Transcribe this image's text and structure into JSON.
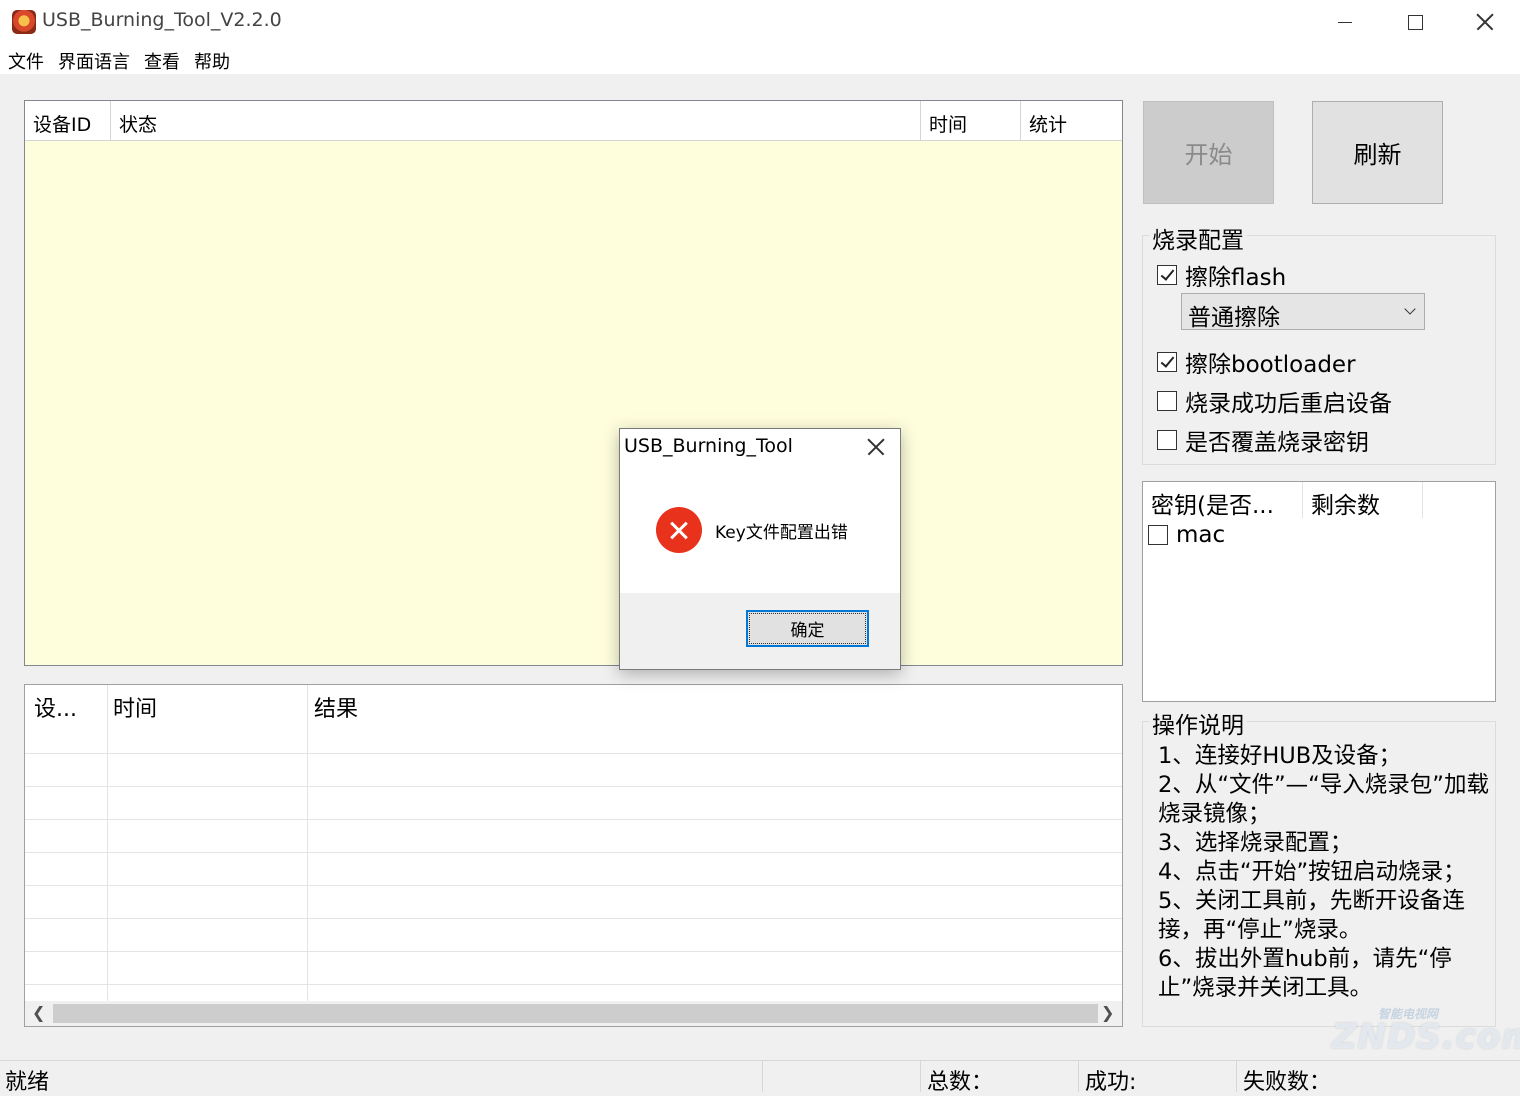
{
  "window": {
    "title": "USB_Burning_Tool_V2.2.0"
  },
  "menu": [
    "文件",
    "界面语言",
    "查看",
    "帮助"
  ],
  "device_table": {
    "columns": [
      "设备ID",
      "状态",
      "时间",
      "统计"
    ]
  },
  "log_table": {
    "columns": [
      "设...",
      "时间",
      "结果"
    ]
  },
  "buttons": {
    "start": "开始",
    "refresh": "刷新"
  },
  "burn_config": {
    "group_title": "烧录配置",
    "erase_flash": {
      "label": "擦除flash",
      "checked": true
    },
    "erase_mode": {
      "value": "普通擦除"
    },
    "erase_bootloader": {
      "label": "擦除bootloader",
      "checked": true
    },
    "reboot_after": {
      "label": "烧录成功后重启设备",
      "checked": false
    },
    "overwrite_key": {
      "label": "是否覆盖烧录密钥",
      "checked": false
    }
  },
  "key_list": {
    "columns": [
      "密钥(是否...",
      "剩余数"
    ],
    "items": [
      {
        "label": "mac",
        "checked": false
      }
    ]
  },
  "instructions": {
    "group_title": "操作说明",
    "lines": [
      "1、连接好HUB及设备；",
      "2、从“文件”—“导入烧录包”加载烧录镜像；",
      "3、选择烧录配置；",
      "4、点击“开始”按钮启动烧录；",
      "5、关闭工具前，先断开设备连接，再“停止”烧录。",
      "6、拔出外置hub前，请先“停止”烧录并关闭工具。"
    ]
  },
  "status_bar": {
    "ready": "就绪",
    "total_label": "总数：",
    "success_label": "成功:",
    "fail_label": "失败数："
  },
  "dialog": {
    "title": "USB_Burning_Tool",
    "message": "Key文件配置出错",
    "ok": "确定",
    "icon": "error-icon"
  },
  "watermark": {
    "small": "智能电视网",
    "big": "ZNDS.com"
  },
  "colors": {
    "device_table_bg": "#fffedc",
    "error_red": "#e8321c",
    "focus_blue": "#0078d7"
  }
}
